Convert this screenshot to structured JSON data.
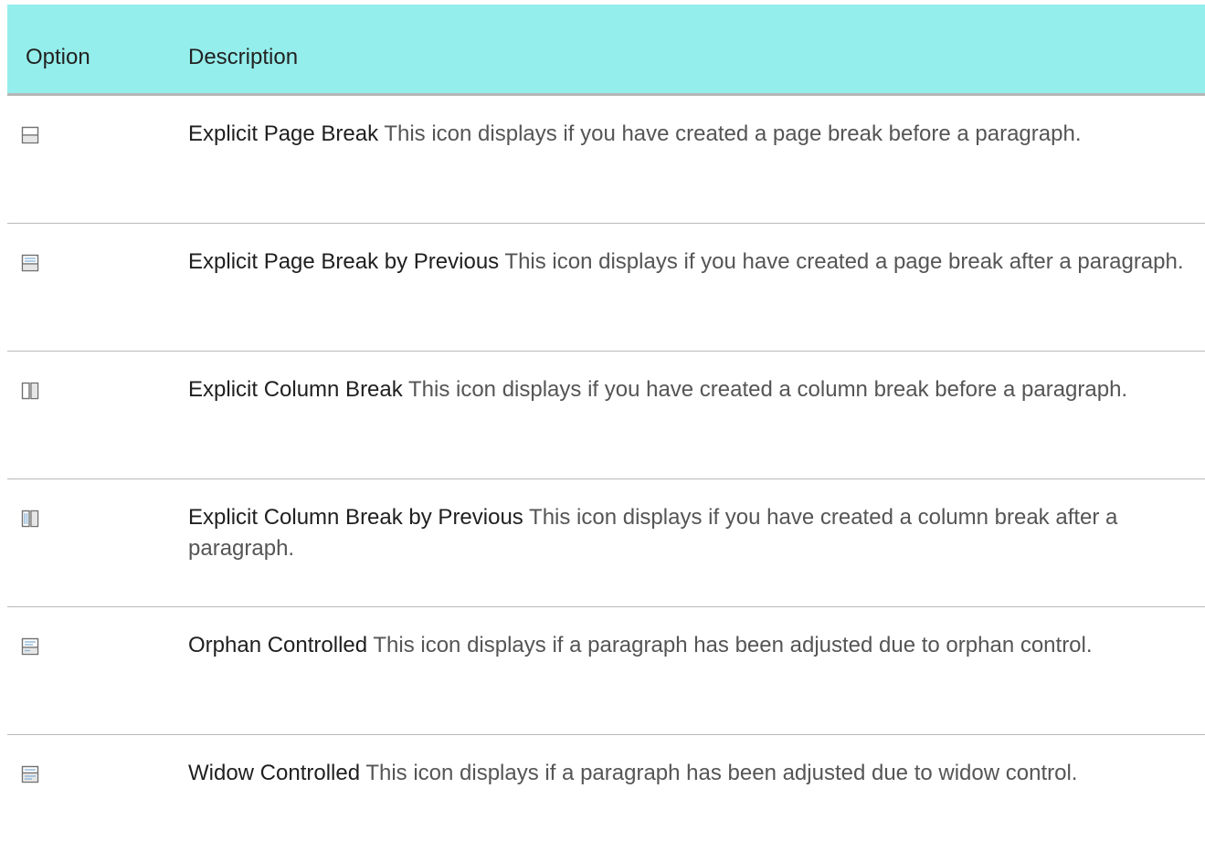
{
  "header": {
    "option": "Option",
    "description": "Description"
  },
  "rows": [
    {
      "icon": "page-break-icon",
      "term": "Explicit Page Break",
      "text": " This icon displays if you have created a page break before a paragraph."
    },
    {
      "icon": "page-break-by-previous-icon",
      "term": "Explicit Page Break by Previous",
      "text": " This icon displays if you have created a page break after a paragraph."
    },
    {
      "icon": "column-break-icon",
      "term": "Explicit Column Break",
      "text": " This icon displays if you have created a column break before a paragraph."
    },
    {
      "icon": "column-break-by-previous-icon",
      "term": "Explicit Column Break by Previous",
      "text": " This icon displays if you have created a column break after a paragraph."
    },
    {
      "icon": "orphan-controlled-icon",
      "term": "Orphan Controlled",
      "text": " This icon displays if a paragraph has been adjusted due to orphan control."
    },
    {
      "icon": "widow-controlled-icon",
      "term": "Widow Controlled",
      "text": " This icon displays if a paragraph has been adjusted due to widow control."
    }
  ],
  "colors": {
    "header_bg": "#94eeec",
    "term_text": "#1f1f1f",
    "body_text": "#555555"
  }
}
